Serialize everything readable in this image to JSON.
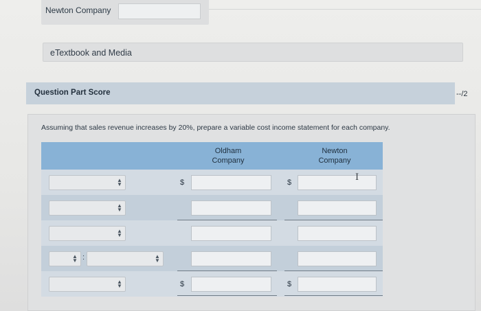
{
  "header": {
    "company_label": "Newton Company",
    "company_value": ""
  },
  "etextbook": {
    "label": "eTextbook and Media"
  },
  "question": {
    "part_score_label": "Question Part Score",
    "score": "--/2"
  },
  "problem": {
    "instruction": "Assuming that sales revenue increases by 20%, prepare a variable cost income statement for each company."
  },
  "table": {
    "columns": [
      {
        "line1": "Oldham",
        "line2": "Company"
      },
      {
        "line1": "Newton",
        "line2": "Company"
      }
    ],
    "currency_symbol": "$",
    "rows": [
      {
        "select": "",
        "oldham": "",
        "newton": "",
        "show_dollar": true
      },
      {
        "select": "",
        "oldham": "",
        "newton": "",
        "show_dollar": false
      },
      {
        "select": "",
        "oldham": "",
        "newton": "",
        "show_dollar": false
      },
      {
        "select_a": "",
        "select_b": "",
        "oldham": "",
        "newton": "",
        "show_dollar": false
      },
      {
        "select": "",
        "oldham": "",
        "newton": "",
        "show_dollar": true
      }
    ]
  }
}
